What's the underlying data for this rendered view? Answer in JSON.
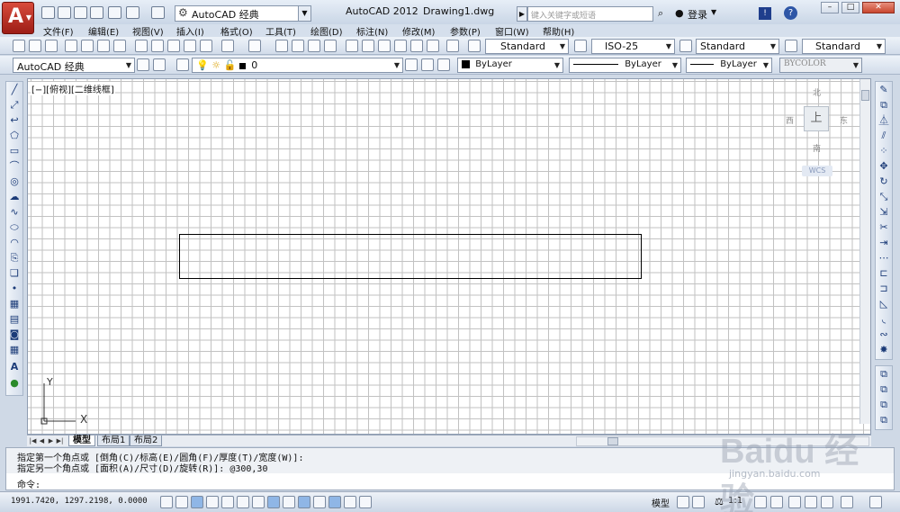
{
  "titlebar": {
    "workspace": "AutoCAD 经典",
    "app_name": "AutoCAD 2012",
    "document": "Drawing1.dwg",
    "help_search_placeholder": "键入关键字或短语",
    "login_label": "登录"
  },
  "menu": [
    "文件(F)",
    "编辑(E)",
    "视图(V)",
    "插入(I)",
    "格式(O)",
    "工具(T)",
    "绘图(D)",
    "标注(N)",
    "修改(M)",
    "参数(P)",
    "窗口(W)",
    "帮助(H)"
  ],
  "styles_toolbar": {
    "text_style": "Standard",
    "dim_style": "ISO-25",
    "table_style": "Standard",
    "multileader_style": "Standard"
  },
  "layers_toolbar": {
    "workspace": "AutoCAD 经典",
    "current_layer": "0",
    "color": "ByLayer",
    "linetype": "ByLayer",
    "lineweight": "ByLayer",
    "plot_style": "BYCOLOR"
  },
  "drawing": {
    "viewport_label": "[−][俯视][二维线框]",
    "viewcube": {
      "north": "北",
      "south": "南",
      "east": "东",
      "west": "西",
      "face": "上",
      "wcs": "WCS"
    },
    "ucs": {
      "x": "X",
      "y": "Y"
    }
  },
  "tabs": [
    "模型",
    "布局1",
    "布局2"
  ],
  "command": {
    "history": [
      "指定第一个角点或 [倒角(C)/标高(E)/圆角(F)/厚度(T)/宽度(W)]:",
      "指定另一个角点或 [面积(A)/尺寸(D)/旋转(R)]: @300,30"
    ],
    "prompt": "命令:"
  },
  "statusbar": {
    "coords": "1991.7420, 1297.2198, 0.0000",
    "model": "模型",
    "scale": "1:1"
  },
  "watermark": {
    "text": "Baidu 经验",
    "url": "jingyan.baidu.com"
  }
}
